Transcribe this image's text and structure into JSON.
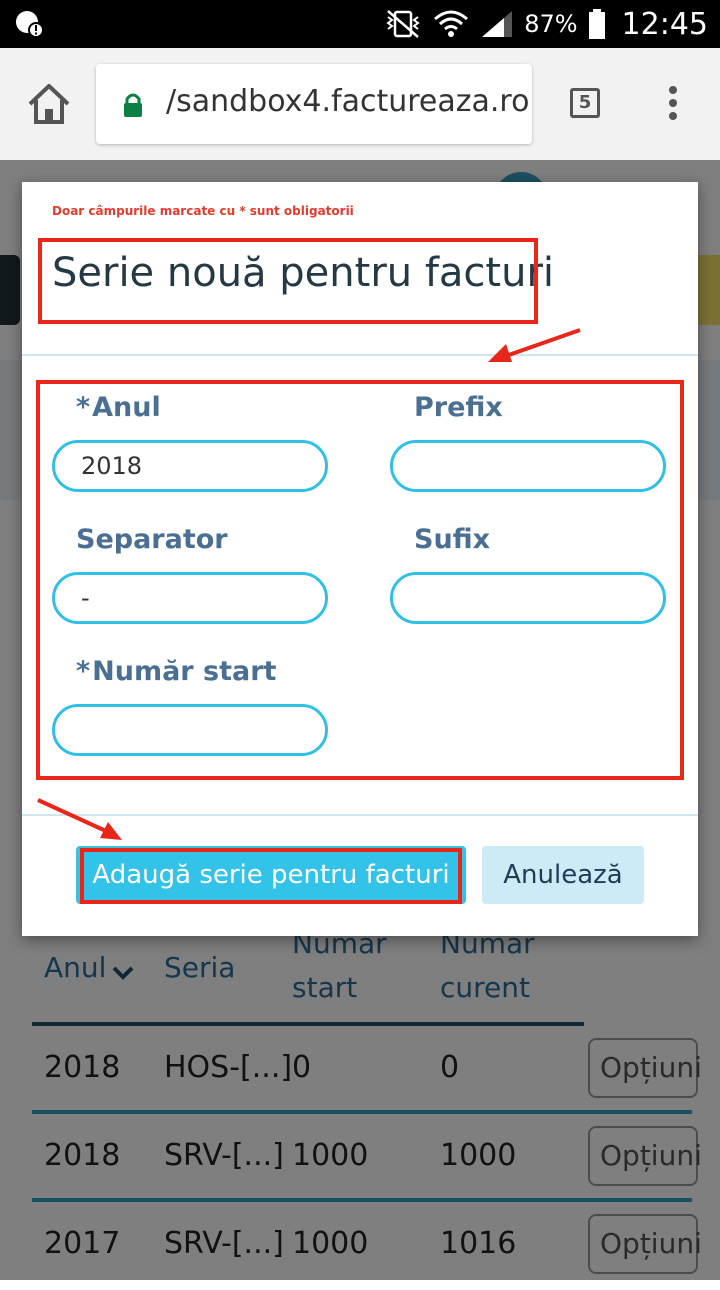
{
  "status_bar": {
    "battery": "87%",
    "time": "12:45"
  },
  "browser": {
    "url": "/sandbox4.factureaza.ro",
    "tab_count": "5"
  },
  "modal": {
    "required_note": "Doar câmpurile marcate cu * sunt obligatorii",
    "title": "Serie nouă pentru facturi",
    "fields": {
      "year": {
        "label": "Anul",
        "value": "2018"
      },
      "prefix": {
        "label": "Prefix",
        "value": ""
      },
      "separator": {
        "label": "Separator",
        "value": "-"
      },
      "suffix": {
        "label": "Sufix",
        "value": ""
      },
      "start_number": {
        "label": "Număr start",
        "value": ""
      }
    },
    "required_marker": "*",
    "submit_label": "Adaugă serie pentru facturi",
    "cancel_label": "Anulează"
  },
  "table": {
    "headers": {
      "year": "Anul",
      "series": "Seria",
      "start_line1": "Număr",
      "start_line2": "start",
      "current_line1": "Număr",
      "current_line2": "curent"
    },
    "rows": [
      {
        "year": "2018",
        "series": "HOS-[...]",
        "start": "0",
        "current": "0",
        "options": "Opțiuni"
      },
      {
        "year": "2018",
        "series": "SRV-[...]",
        "start": "1000",
        "current": "1000",
        "options": "Opțiuni"
      },
      {
        "year": "2017",
        "series": "SRV-[...]",
        "start": "1000",
        "current": "1016",
        "options": "Opțiuni"
      }
    ]
  },
  "colors": {
    "accent": "#33c2e8",
    "highlight": "#e8261a",
    "label": "#4b6f92"
  }
}
